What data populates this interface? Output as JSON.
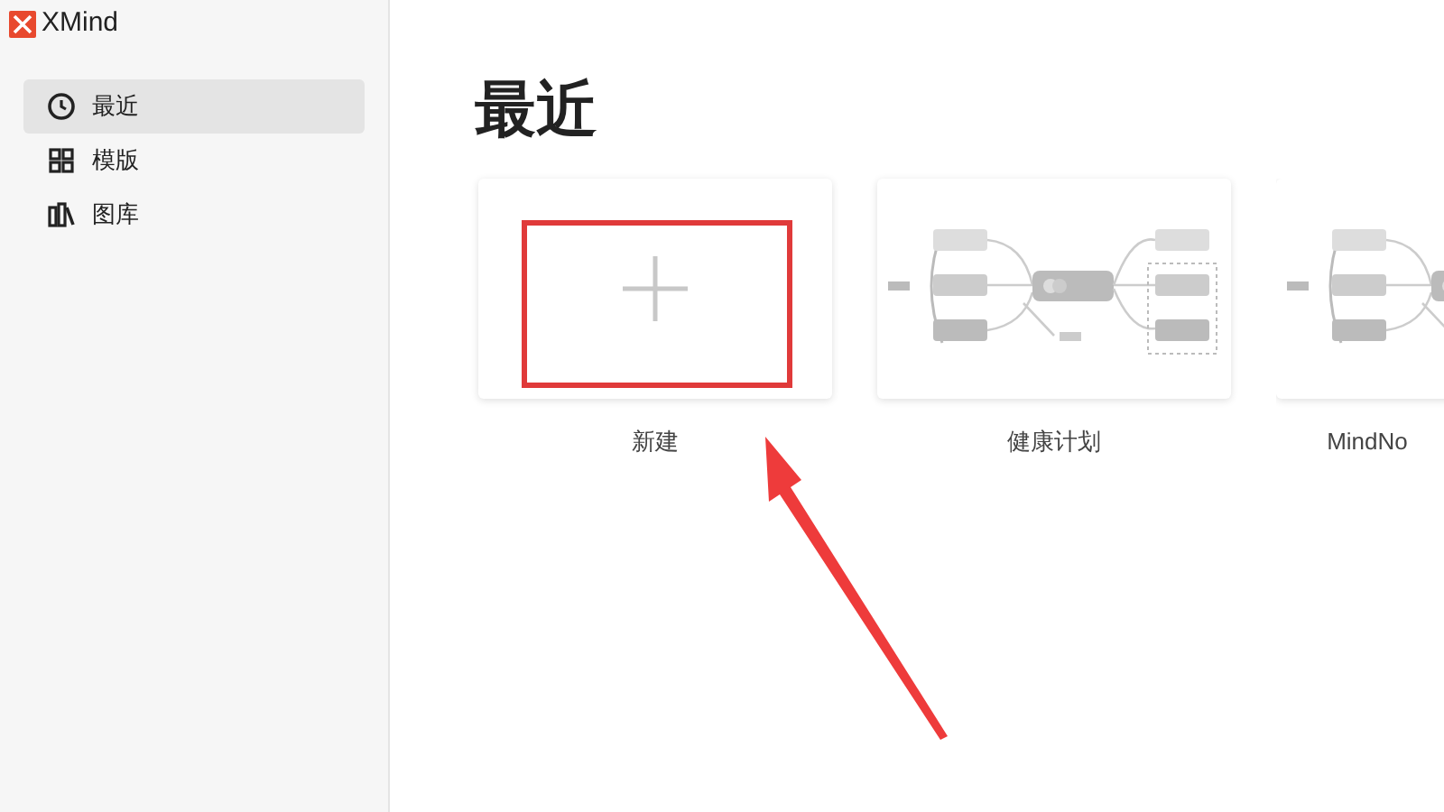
{
  "app": {
    "name": "XMind"
  },
  "sidebar": {
    "items": [
      {
        "label": "最近",
        "kind": "recent",
        "selected": true
      },
      {
        "label": "模版",
        "kind": "templates",
        "selected": false
      },
      {
        "label": "图库",
        "kind": "library",
        "selected": false
      }
    ]
  },
  "main": {
    "heading": "最近",
    "cards": [
      {
        "kind": "new",
        "label": "新建"
      },
      {
        "kind": "template",
        "label": "健康计划"
      },
      {
        "kind": "template",
        "label": "MindNo"
      }
    ]
  }
}
